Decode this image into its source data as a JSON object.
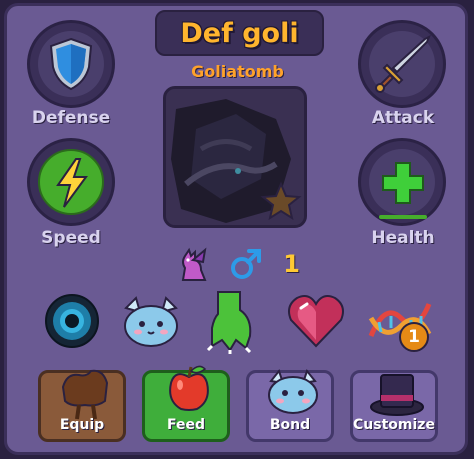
{
  "pet": {
    "name": "Def goli",
    "species": "Goliatomb",
    "level": "1",
    "gender_icon": "male-symbol-icon"
  },
  "stats": {
    "defense_label": "Defense",
    "attack_label": "Attack",
    "speed_label": "Speed",
    "health_label": "Health"
  },
  "items": [
    {
      "icon": "eye-orb-icon"
    },
    {
      "icon": "blue-creature-face-icon"
    },
    {
      "icon": "green-claw-icon"
    },
    {
      "icon": "heart-gem-icon"
    },
    {
      "icon": "dna-icon",
      "badge": "1"
    }
  ],
  "actions": {
    "equip_label": "Equip",
    "feed_label": "Feed",
    "bond_label": "Bond",
    "customize_label": "Customize"
  },
  "colors": {
    "panel": "#6a5a93",
    "name": "#ffb52e",
    "feed_active": "#3fae3b",
    "speed_active": "#46ad2c"
  }
}
